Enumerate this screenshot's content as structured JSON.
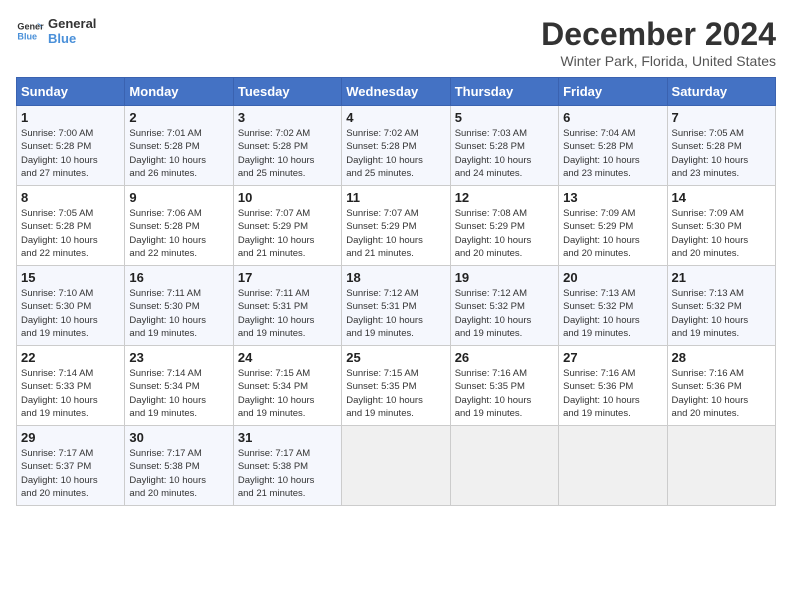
{
  "logo": {
    "line1": "General",
    "line2": "Blue"
  },
  "title": "December 2024",
  "location": "Winter Park, Florida, United States",
  "headers": [
    "Sunday",
    "Monday",
    "Tuesday",
    "Wednesday",
    "Thursday",
    "Friday",
    "Saturday"
  ],
  "weeks": [
    [
      {
        "day": "1",
        "info": "Sunrise: 7:00 AM\nSunset: 5:28 PM\nDaylight: 10 hours\nand 27 minutes."
      },
      {
        "day": "2",
        "info": "Sunrise: 7:01 AM\nSunset: 5:28 PM\nDaylight: 10 hours\nand 26 minutes."
      },
      {
        "day": "3",
        "info": "Sunrise: 7:02 AM\nSunset: 5:28 PM\nDaylight: 10 hours\nand 25 minutes."
      },
      {
        "day": "4",
        "info": "Sunrise: 7:02 AM\nSunset: 5:28 PM\nDaylight: 10 hours\nand 25 minutes."
      },
      {
        "day": "5",
        "info": "Sunrise: 7:03 AM\nSunset: 5:28 PM\nDaylight: 10 hours\nand 24 minutes."
      },
      {
        "day": "6",
        "info": "Sunrise: 7:04 AM\nSunset: 5:28 PM\nDaylight: 10 hours\nand 23 minutes."
      },
      {
        "day": "7",
        "info": "Sunrise: 7:05 AM\nSunset: 5:28 PM\nDaylight: 10 hours\nand 23 minutes."
      }
    ],
    [
      {
        "day": "8",
        "info": "Sunrise: 7:05 AM\nSunset: 5:28 PM\nDaylight: 10 hours\nand 22 minutes."
      },
      {
        "day": "9",
        "info": "Sunrise: 7:06 AM\nSunset: 5:28 PM\nDaylight: 10 hours\nand 22 minutes."
      },
      {
        "day": "10",
        "info": "Sunrise: 7:07 AM\nSunset: 5:29 PM\nDaylight: 10 hours\nand 21 minutes."
      },
      {
        "day": "11",
        "info": "Sunrise: 7:07 AM\nSunset: 5:29 PM\nDaylight: 10 hours\nand 21 minutes."
      },
      {
        "day": "12",
        "info": "Sunrise: 7:08 AM\nSunset: 5:29 PM\nDaylight: 10 hours\nand 20 minutes."
      },
      {
        "day": "13",
        "info": "Sunrise: 7:09 AM\nSunset: 5:29 PM\nDaylight: 10 hours\nand 20 minutes."
      },
      {
        "day": "14",
        "info": "Sunrise: 7:09 AM\nSunset: 5:30 PM\nDaylight: 10 hours\nand 20 minutes."
      }
    ],
    [
      {
        "day": "15",
        "info": "Sunrise: 7:10 AM\nSunset: 5:30 PM\nDaylight: 10 hours\nand 19 minutes."
      },
      {
        "day": "16",
        "info": "Sunrise: 7:11 AM\nSunset: 5:30 PM\nDaylight: 10 hours\nand 19 minutes."
      },
      {
        "day": "17",
        "info": "Sunrise: 7:11 AM\nSunset: 5:31 PM\nDaylight: 10 hours\nand 19 minutes."
      },
      {
        "day": "18",
        "info": "Sunrise: 7:12 AM\nSunset: 5:31 PM\nDaylight: 10 hours\nand 19 minutes."
      },
      {
        "day": "19",
        "info": "Sunrise: 7:12 AM\nSunset: 5:32 PM\nDaylight: 10 hours\nand 19 minutes."
      },
      {
        "day": "20",
        "info": "Sunrise: 7:13 AM\nSunset: 5:32 PM\nDaylight: 10 hours\nand 19 minutes."
      },
      {
        "day": "21",
        "info": "Sunrise: 7:13 AM\nSunset: 5:32 PM\nDaylight: 10 hours\nand 19 minutes."
      }
    ],
    [
      {
        "day": "22",
        "info": "Sunrise: 7:14 AM\nSunset: 5:33 PM\nDaylight: 10 hours\nand 19 minutes."
      },
      {
        "day": "23",
        "info": "Sunrise: 7:14 AM\nSunset: 5:34 PM\nDaylight: 10 hours\nand 19 minutes."
      },
      {
        "day": "24",
        "info": "Sunrise: 7:15 AM\nSunset: 5:34 PM\nDaylight: 10 hours\nand 19 minutes."
      },
      {
        "day": "25",
        "info": "Sunrise: 7:15 AM\nSunset: 5:35 PM\nDaylight: 10 hours\nand 19 minutes."
      },
      {
        "day": "26",
        "info": "Sunrise: 7:16 AM\nSunset: 5:35 PM\nDaylight: 10 hours\nand 19 minutes."
      },
      {
        "day": "27",
        "info": "Sunrise: 7:16 AM\nSunset: 5:36 PM\nDaylight: 10 hours\nand 19 minutes."
      },
      {
        "day": "28",
        "info": "Sunrise: 7:16 AM\nSunset: 5:36 PM\nDaylight: 10 hours\nand 20 minutes."
      }
    ],
    [
      {
        "day": "29",
        "info": "Sunrise: 7:17 AM\nSunset: 5:37 PM\nDaylight: 10 hours\nand 20 minutes."
      },
      {
        "day": "30",
        "info": "Sunrise: 7:17 AM\nSunset: 5:38 PM\nDaylight: 10 hours\nand 20 minutes."
      },
      {
        "day": "31",
        "info": "Sunrise: 7:17 AM\nSunset: 5:38 PM\nDaylight: 10 hours\nand 21 minutes."
      },
      {
        "day": "",
        "info": ""
      },
      {
        "day": "",
        "info": ""
      },
      {
        "day": "",
        "info": ""
      },
      {
        "day": "",
        "info": ""
      }
    ]
  ]
}
